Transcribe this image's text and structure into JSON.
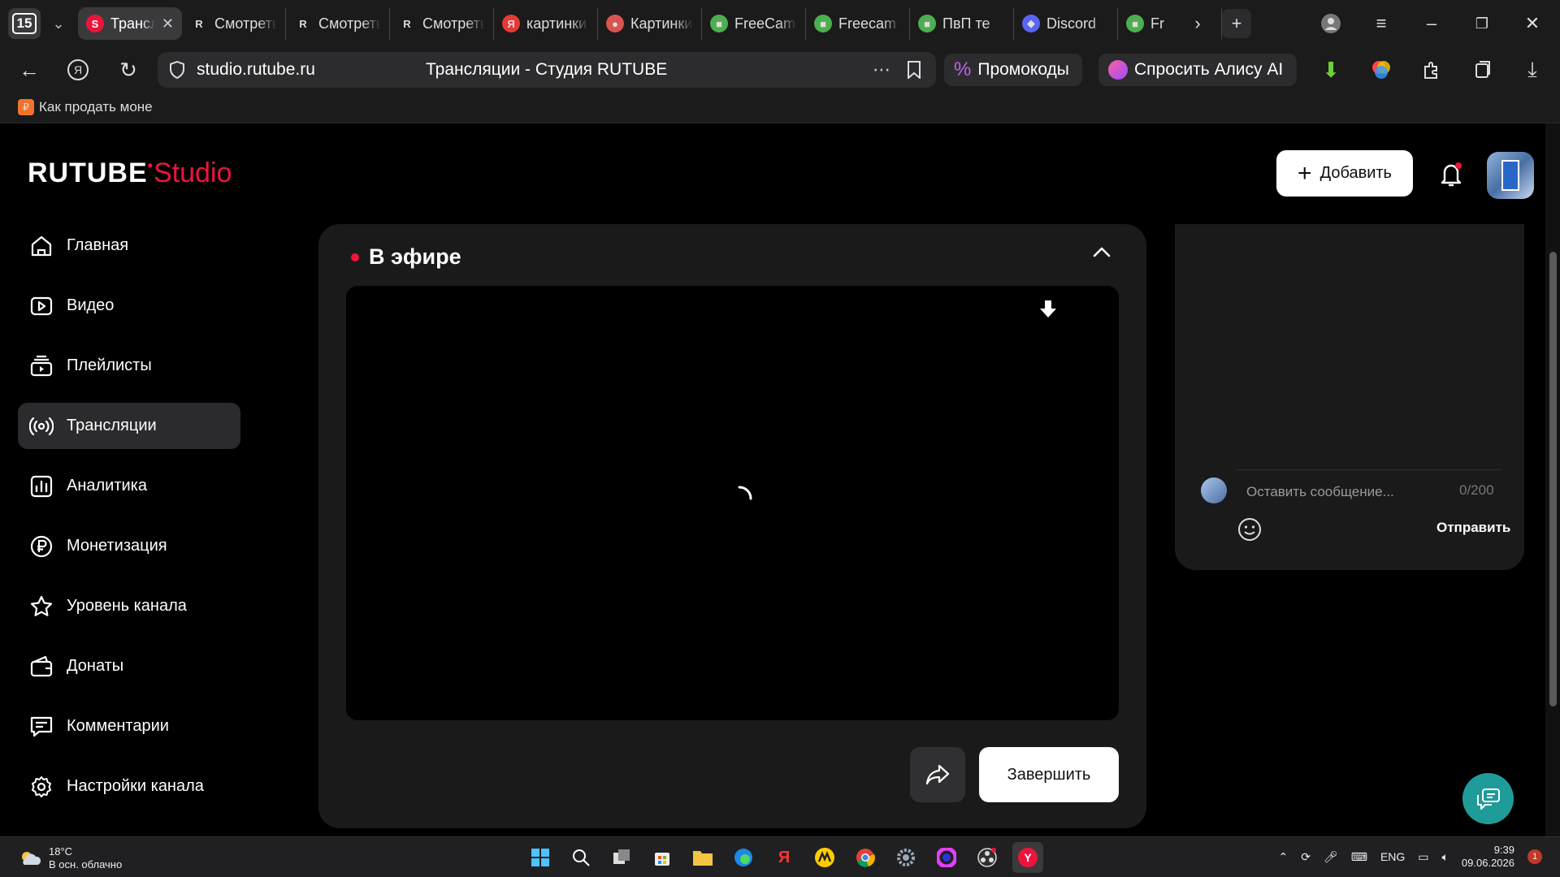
{
  "browser": {
    "tab_count": "15",
    "tabs": [
      {
        "title": "Трансляции",
        "favicon": "S",
        "color": "#ed143b",
        "active": true
      },
      {
        "title": "Смотреть",
        "favicon": "R",
        "color": "#1a1a1a",
        "active": false
      },
      {
        "title": "Смотреть",
        "favicon": "R",
        "color": "#1a1a1a",
        "active": false
      },
      {
        "title": "Смотреть",
        "favicon": "R",
        "color": "#1a1a1a",
        "active": false
      },
      {
        "title": "картинки",
        "favicon": "Я",
        "color": "#e53935",
        "active": false
      },
      {
        "title": "Картинки",
        "favicon": "●",
        "color": "#d9534f",
        "active": false
      },
      {
        "title": "FreeCam",
        "favicon": "■",
        "color": "#4caf50",
        "active": false
      },
      {
        "title": "Freecam",
        "favicon": "■",
        "color": "#4caf50",
        "active": false
      },
      {
        "title": "ПвП те",
        "favicon": "■",
        "color": "#4caf50",
        "active": false
      },
      {
        "title": "Discord",
        "favicon": "◆",
        "color": "#5865f2",
        "active": false
      },
      {
        "title": "Fr",
        "favicon": "■",
        "color": "#4caf50",
        "active": false
      }
    ],
    "url": "studio.rutube.ru",
    "page_title": "Трансляции - Студия RUTUBE",
    "promo_label": "Промокоды",
    "alice_label": "Спросить Алису AI",
    "bookmark": "Как продать моне"
  },
  "app": {
    "logo_main": "RUTUBE",
    "logo_studio": "Studio",
    "add_button": "Добавить",
    "nav": [
      {
        "label": "Главная",
        "icon": "home-icon",
        "active": false
      },
      {
        "label": "Видео",
        "icon": "video-icon",
        "active": false
      },
      {
        "label": "Плейлисты",
        "icon": "playlist-icon",
        "active": false
      },
      {
        "label": "Трансляции",
        "icon": "broadcast-icon",
        "active": true
      },
      {
        "label": "Аналитика",
        "icon": "analytics-icon",
        "active": false
      },
      {
        "label": "Монетизация",
        "icon": "ruble-icon",
        "active": false
      },
      {
        "label": "Уровень канала",
        "icon": "star-icon",
        "active": false
      },
      {
        "label": "Донаты",
        "icon": "wallet-icon",
        "active": false
      },
      {
        "label": "Комментарии",
        "icon": "comment-icon",
        "active": false
      },
      {
        "label": "Настройки канала",
        "icon": "gear-icon",
        "active": false
      }
    ],
    "live": {
      "title": "В эфире",
      "finish_button": "Завершить"
    },
    "chat": {
      "placeholder": "Оставить сообщение...",
      "counter": "0/200",
      "send_button": "Отправить"
    }
  },
  "taskbar": {
    "temp": "18°C",
    "weather": "В осн. облачно",
    "lang": "ENG",
    "time": "9:39",
    "date": "09.06.2026",
    "notifications": "1"
  }
}
